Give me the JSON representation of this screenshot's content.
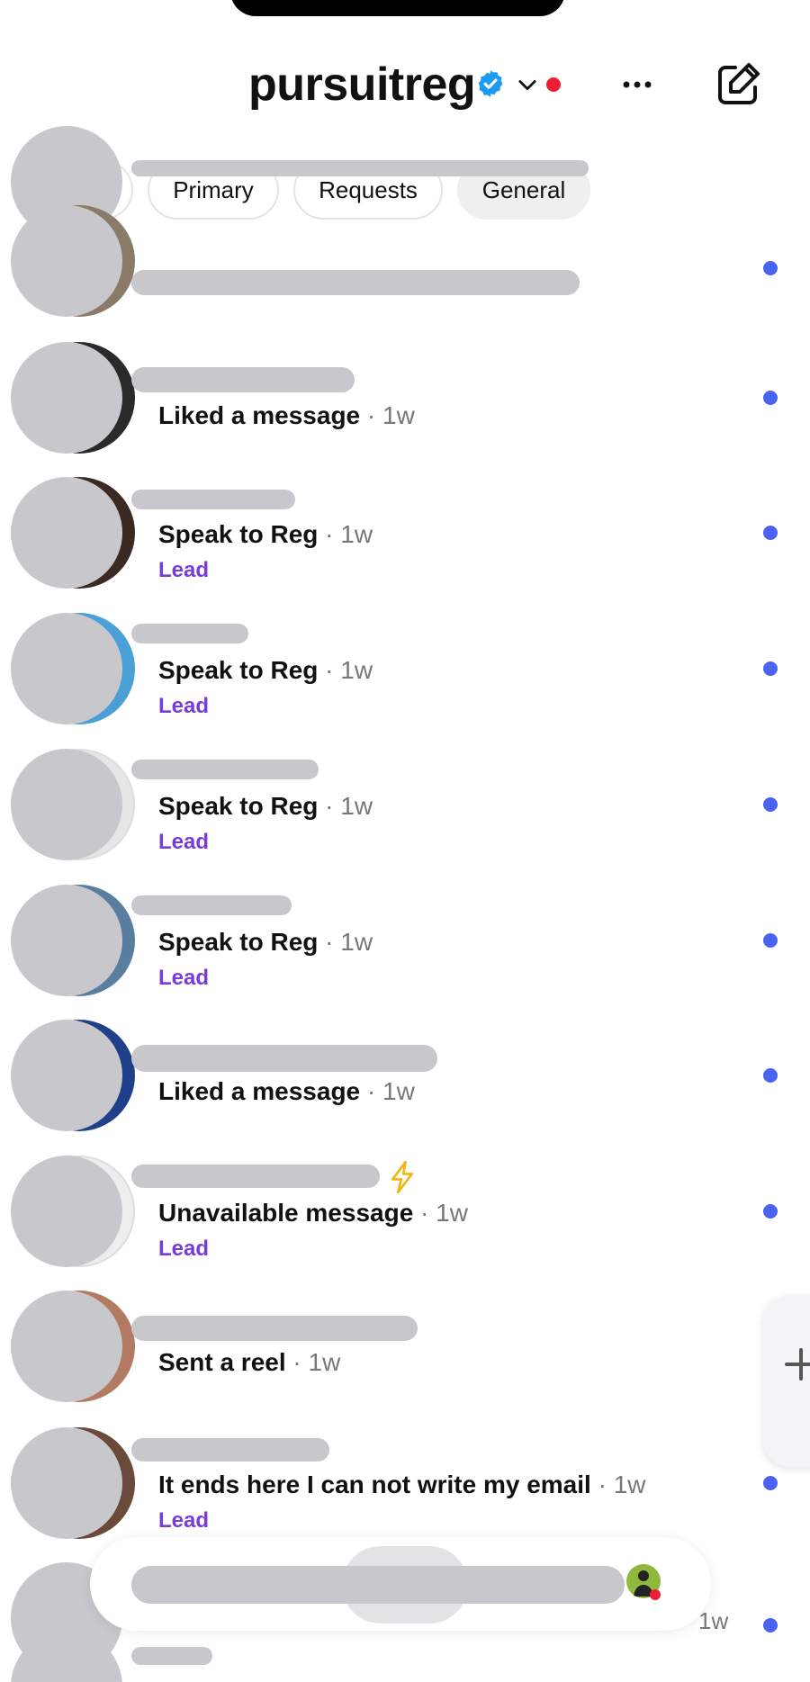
{
  "header": {
    "account_name": "pursuitreg",
    "icons": [
      "verified-badge-icon",
      "chevron-down-icon",
      "more-icon",
      "compose-icon"
    ]
  },
  "tabs": [
    {
      "label": "Primary",
      "active": false
    },
    {
      "label": "Requests",
      "active": false
    },
    {
      "label": "General",
      "active": true
    }
  ],
  "threads": [
    {
      "message": "",
      "time": "",
      "lead": "",
      "unread": true
    },
    {
      "message": "Liked a message",
      "time": " · 1w",
      "lead": "",
      "unread": true
    },
    {
      "message": "Speak to Reg",
      "time": " · 1w",
      "lead": "Lead",
      "unread": true
    },
    {
      "message": "Speak to Reg",
      "time": " · 1w",
      "lead": "Lead",
      "unread": true
    },
    {
      "message": "Speak to Reg",
      "time": " · 1w",
      "lead": "Lead",
      "unread": true
    },
    {
      "message": "Speak to Reg",
      "time": " · 1w",
      "lead": "Lead",
      "unread": true
    },
    {
      "message": "Liked a message",
      "time": " · 1w",
      "lead": "",
      "unread": true
    },
    {
      "message": "Unavailable message",
      "time": " · 1w",
      "lead": "Lead",
      "unread": true
    },
    {
      "message": "Sent a reel",
      "time": " · 1w",
      "lead": "",
      "unread": false
    },
    {
      "message": "It ends here I can not write my email",
      "time": " · 1w",
      "lead": "Lead",
      "unread": true
    }
  ],
  "last_row": {
    "time": "1w",
    "unread": true
  },
  "colors": {
    "unread_dot": "#4a64f0",
    "lead_label": "#7a3bdb",
    "notification_dot": "#ee1d36",
    "verified_badge": "#1d9bf0",
    "redaction": "#c8c8cc"
  }
}
